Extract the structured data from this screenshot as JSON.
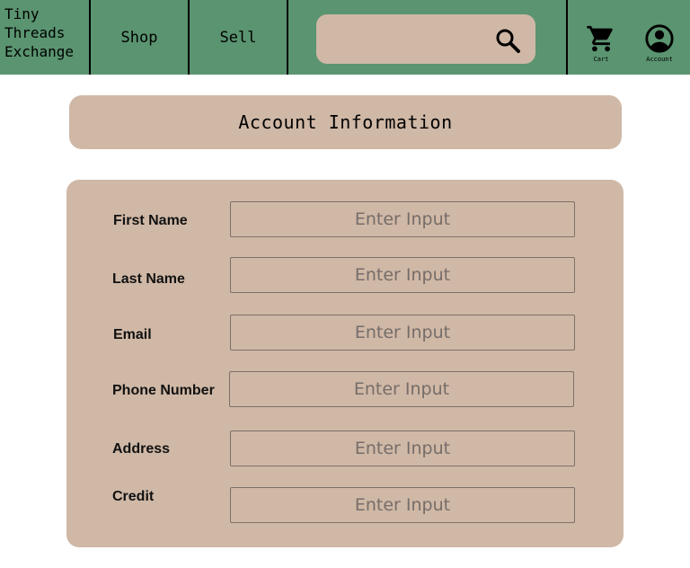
{
  "brand": {
    "lines": [
      "Tiny",
      "Threads",
      "Exchange"
    ]
  },
  "nav": {
    "shop_label": "Shop",
    "sell_label": "Sell",
    "cart_label": "Cart",
    "account_label": "Account"
  },
  "search": {
    "value": "",
    "placeholder": ""
  },
  "icons": {
    "search": "search-icon",
    "cart": "cart-icon",
    "account": "account-circle-icon"
  },
  "colors": {
    "nav_bg": "#5a9470",
    "card_bg": "#d0b8a6",
    "border": "#000000"
  },
  "page": {
    "title": "Account Information"
  },
  "form": {
    "fields": [
      {
        "label": "First Name",
        "value": "",
        "placeholder": "Enter Input"
      },
      {
        "label": "Last Name",
        "value": "",
        "placeholder": "Enter Input"
      },
      {
        "label": "Email",
        "value": "",
        "placeholder": "Enter Input"
      },
      {
        "label": "Phone Number",
        "value": "",
        "placeholder": "Enter Input"
      },
      {
        "label": "Address",
        "value": "",
        "placeholder": "Enter Input"
      },
      {
        "label": "Credit",
        "value": "",
        "placeholder": "Enter Input"
      }
    ]
  }
}
